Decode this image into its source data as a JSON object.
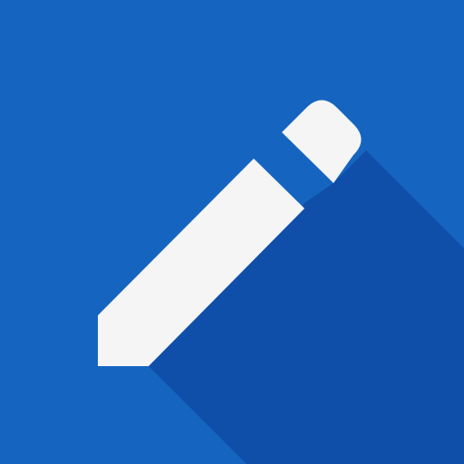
{
  "icon": {
    "name": "pencil-edit-icon",
    "colors": {
      "background": "#1565c0",
      "long_shadow": "#0d47a1",
      "glyph": "#f5f5f5"
    }
  }
}
